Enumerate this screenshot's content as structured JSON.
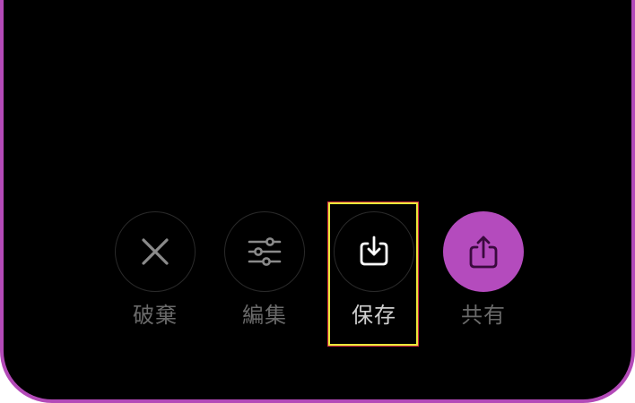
{
  "actions": {
    "discard": {
      "label": "破棄",
      "icon": "close-icon"
    },
    "edit": {
      "label": "編集",
      "icon": "sliders-icon"
    },
    "save": {
      "label": "保存",
      "icon": "download-icon"
    },
    "share": {
      "label": "共有",
      "icon": "share-icon"
    }
  },
  "colors": {
    "background": "#000000",
    "frame": "#b34ab8",
    "share_fill": "#b44bbd",
    "highlight": "#e8e83a"
  }
}
